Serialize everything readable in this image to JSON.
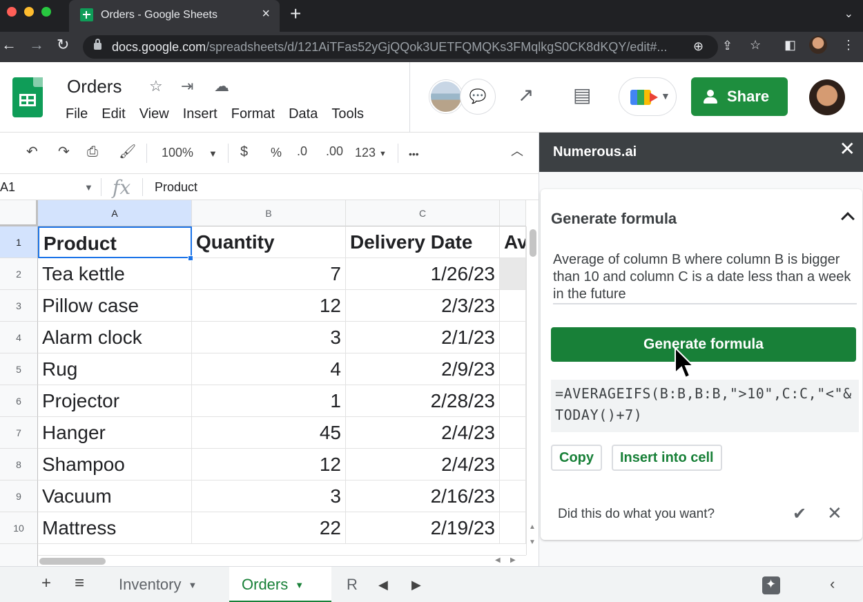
{
  "browser": {
    "tab_title": "Orders - Google Sheets",
    "tab_close_icon": "×",
    "new_tab_icon": "+",
    "url_host": "docs.google.com",
    "url_path": "/spreadsheets/d/121AiTFas52yGjQQok3UETFQMQKs3FMqlkgS0CK8dKQY/edit#..."
  },
  "sheets": {
    "title": "Orders",
    "menu": [
      "File",
      "Edit",
      "View",
      "Insert",
      "Format",
      "Data",
      "Tools"
    ],
    "share_label": "Share"
  },
  "toolbar": {
    "zoom": "100%",
    "currency": "$",
    "percent": "%",
    "decrease_decimal": ".0",
    "increase_decimal": ".00",
    "number_format": "123",
    "more": "•••"
  },
  "formula_bar": {
    "cell_ref": "A1",
    "fx": "fx",
    "value": "Product"
  },
  "grid": {
    "columns": [
      "A",
      "B",
      "C"
    ],
    "rows": [
      {
        "n": "1",
        "a": "Product",
        "b": "Quantity",
        "c": "Delivery Date",
        "d": "Av"
      },
      {
        "n": "2",
        "a": "Tea kettle",
        "b": "7",
        "c": "1/26/23"
      },
      {
        "n": "3",
        "a": "Pillow case",
        "b": "12",
        "c": "2/3/23"
      },
      {
        "n": "4",
        "a": "Alarm clock",
        "b": "3",
        "c": "2/1/23"
      },
      {
        "n": "5",
        "a": "Rug",
        "b": "4",
        "c": "2/9/23"
      },
      {
        "n": "6",
        "a": "Projector",
        "b": "1",
        "c": "2/28/23"
      },
      {
        "n": "7",
        "a": "Hanger",
        "b": "45",
        "c": "2/4/23"
      },
      {
        "n": "8",
        "a": "Shampoo",
        "b": "12",
        "c": "2/4/23"
      },
      {
        "n": "9",
        "a": "Vacuum",
        "b": "3",
        "c": "2/16/23"
      },
      {
        "n": "10",
        "a": "Mattress",
        "b": "22",
        "c": "2/19/23"
      }
    ]
  },
  "sheet_tabs": {
    "inventory": "Inventory",
    "orders": "Orders",
    "partial": "R"
  },
  "panel": {
    "title": "Numerous.ai",
    "section_title": "Generate formula",
    "prompt": "Average of column B where column B is bigger than 10 and column C is a date less than a week in the future",
    "generate_label": "Generate formula",
    "formula": "=AVERAGEIFS(B:B,B:B,\">10\",C:C,\"<\"&TODAY()+7)",
    "copy_label": "Copy",
    "insert_label": "Insert into cell",
    "feedback_question": "Did this do what you want?"
  },
  "colors": {
    "accent_green": "#188038",
    "selection_blue": "#1a73e8",
    "panel_header": "#3c4043"
  }
}
